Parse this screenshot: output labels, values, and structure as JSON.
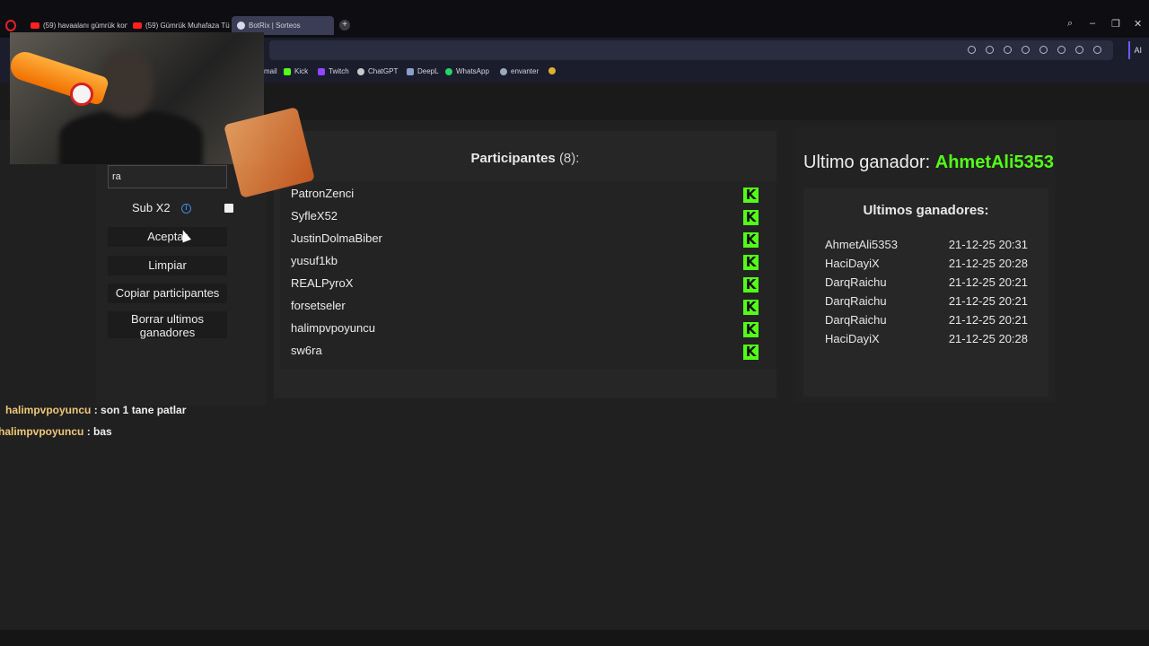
{
  "browser": {
    "tabs": [
      {
        "label": "(59) havaalanı gümrük kon",
        "icon": "youtube-icon"
      },
      {
        "label": "(59) Gümrük Muhafaza Tü",
        "icon": "youtube-icon"
      },
      {
        "label": "BotRix | Sorteos",
        "icon": "botrix-icon"
      }
    ],
    "new_tab": "+",
    "ai_label": "AI",
    "bookmarks": [
      {
        "label": "mail",
        "icon": "mail-icon",
        "color": "#d44638"
      },
      {
        "label": "Kick",
        "icon": "kick-icon",
        "color": "#53fc18"
      },
      {
        "label": "Twitch",
        "icon": "twitch-icon",
        "color": "#9146ff"
      },
      {
        "label": "ChatGPT",
        "icon": "chatgpt-icon",
        "color": "#c8c8c8"
      },
      {
        "label": "DeepL",
        "icon": "deepl-icon",
        "color": "#0f2b46"
      },
      {
        "label": "WhatsApp",
        "icon": "whatsapp-icon",
        "color": "#25d366"
      },
      {
        "label": "envanter",
        "icon": "steam-icon",
        "color": "#9ab"
      }
    ]
  },
  "controls": {
    "keyword_value": "ra",
    "sub_label": "Sub X2",
    "info_glyph": "i",
    "accept_label": "Aceptar",
    "clear_label": "Limpiar",
    "copy_label": "Copiar participantes",
    "delete_label_line1": "Borrar ultimos",
    "delete_label_line2": "ganadores"
  },
  "participants": {
    "title": "Participantes",
    "count": "(8):",
    "platform_glyph": "K",
    "list": [
      "PatronZenci",
      "SyfleX52",
      "JustinDolmaBiber",
      "yusuf1kb",
      "REALPyroX",
      "forsetseler",
      "halimpvpoyuncu",
      "sw6ra"
    ]
  },
  "winners": {
    "last_label": "Ultimo ganador:",
    "last_name": "AhmetAli5353",
    "list_title": "Ultimos ganadores:",
    "list": [
      {
        "name": "AhmetAli5353",
        "time": "21-12-25 20:31"
      },
      {
        "name": "HaciDayiX",
        "time": "21-12-25 20:28"
      },
      {
        "name": "DarqRaichu",
        "time": "21-12-25 20:21"
      },
      {
        "name": "DarqRaichu",
        "time": "21-12-25 20:21"
      },
      {
        "name": "DarqRaichu",
        "time": "21-12-25 20:21"
      },
      {
        "name": "HaciDayiX",
        "time": "21-12-25 20:28"
      }
    ]
  },
  "chat": [
    {
      "user": "halimpvpoyuncu",
      "message": ": son 1 tane patlar"
    },
    {
      "user": "halimpvpoyuncu",
      "message": ": bas"
    }
  ],
  "colors": {
    "kick_green": "#53fc18",
    "info_blue": "#3b8ae6",
    "chat_user": "#f0c878"
  }
}
